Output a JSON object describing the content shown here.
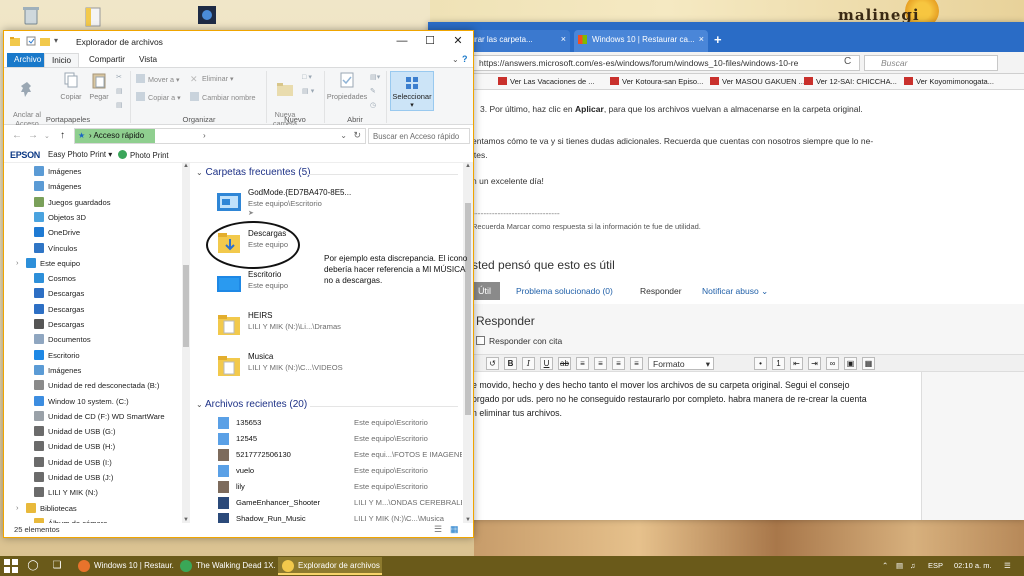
{
  "colors": {
    "accent": "#1979ca",
    "selection": "#cce4f7",
    "explorer_border": "#f0a500",
    "browser_tabbar": "#2a6cc6",
    "taskbar": "#6a5a1a",
    "section_header": "#1e3287",
    "annotation": "#111111"
  },
  "browser": {
    "tabs": [
      {
        "label": "o restaurar las carpeta...",
        "close": "×"
      },
      {
        "label": "Windows 10 | Restaurar ca...",
        "close": "×"
      }
    ],
    "new_tab": "+",
    "url": "https://answers.microsoft.com/es-es/windows/forum/windows_10-files/windows-10-re",
    "reload": "C",
    "search_placeholder": "Buscar",
    "bookmarks": [
      "Ver Las Vacaciones de ...",
      "Ver Kotoura-san Episo...",
      "Ver MASOU GAKUEN ...",
      "Ver 12-SAI: CHICCHA...",
      "Ver Koyomimonogata..."
    ],
    "content": {
      "step_prefix": "3. Por último, haz clic en",
      "step_bold": "Aplicar",
      "step_suffix": ", para que los archivos vuelvan a almacenarse en la carpeta original.",
      "line2a": "entamos cómo te va y si tienes dudas adicionales. Recuerda que cuentas con nosotros siempre que lo ne-",
      "line2b": "ites.",
      "greeting": "n un excelente día!",
      "sep_text": "-------------------------------",
      "helpful_note": "Recuerda Marcar como respuesta si la información te fue de utilidad.",
      "heading": "sted pensó que esto es útil",
      "util": "Útil",
      "solved": "Problema solucionado (0)",
      "reply": "Responder",
      "abuse": "Notificar abuso",
      "reply_title": "Responder",
      "reply_quote": "Responder con cita",
      "format_select": "Formato",
      "reply_body": [
        "e movido, hecho y des hecho tanto el mover los archivos de su carpeta original. Segui el consejo",
        "orgado por uds. pero no he conseguido restaurarlo por completo. habra manera de re-crear la cuenta",
        "n eliminar tus archivos."
      ]
    }
  },
  "explorer": {
    "title": "Explorador de archivos",
    "ribbon_tabs": [
      "Archivo",
      "Inicio",
      "Compartir",
      "Vista"
    ],
    "ribbon": {
      "pin": "Anclar al\nAcceso rápido",
      "copy": "Copiar",
      "paste": "Pegar",
      "group_clipboard": "Portapapeles",
      "move_to": "Mover a",
      "copy_to": "Copiar a",
      "delete": "Eliminar",
      "rename": "Cambiar nombre",
      "group_organize": "Organizar",
      "new_folder": "Nueva\ncarpeta",
      "group_new": "Nuevo",
      "properties": "Propiedades",
      "group_open": "Abrir",
      "select": "Seleccionar"
    },
    "address_path": "Acceso rápido",
    "address_chevron": "›",
    "search_placeholder": "Buscar en Acceso rápido",
    "epson_toolbar": {
      "brand": "EPSON",
      "easy_photo": "Easy Photo Print",
      "photo_print": "Photo Print"
    },
    "nav_items": [
      {
        "label": "Imágenes",
        "icon": "images-icon",
        "level": 1,
        "color": "#5b9bd5"
      },
      {
        "label": "Imágenes",
        "icon": "images-icon",
        "level": 1,
        "color": "#5b9bd5"
      },
      {
        "label": "Juegos guardados",
        "icon": "saved-games-icon",
        "level": 1,
        "color": "#7aa05a"
      },
      {
        "label": "Objetos 3D",
        "icon": "3d-objects-icon",
        "level": 1,
        "color": "#4aa3df"
      },
      {
        "label": "OneDrive",
        "icon": "onedrive-icon",
        "level": 1,
        "color": "#1f7ad3"
      },
      {
        "label": "Vínculos",
        "icon": "links-icon",
        "level": 1,
        "color": "#2f75c5"
      },
      {
        "label": "Este equipo",
        "icon": "this-pc-icon",
        "level": 0,
        "color": "#2d8fd9"
      },
      {
        "label": "Cosmos",
        "icon": "folder-icon",
        "level": 1,
        "color": "#2d8fd9"
      },
      {
        "label": "Descargas",
        "icon": "downloads-icon",
        "level": 1,
        "color": "#2d6fc4"
      },
      {
        "label": "Descargas",
        "icon": "downloads-icon",
        "level": 1,
        "color": "#2d6fc4"
      },
      {
        "label": "Descargas",
        "icon": "downloads-icon",
        "level": 1,
        "color": "#555555"
      },
      {
        "label": "Documentos",
        "icon": "documents-icon",
        "level": 1,
        "color": "#8fa6c0"
      },
      {
        "label": "Escritorio",
        "icon": "desktop-icon",
        "level": 1,
        "color": "#1e88e5"
      },
      {
        "label": "Imágenes",
        "icon": "images-icon",
        "level": 1,
        "color": "#5b9bd5"
      },
      {
        "label": "Unidad de red desconectada (B:)",
        "icon": "network-drive-icon",
        "level": 1,
        "color": "#8a8a8a"
      },
      {
        "label": "Window 10 system. (C:)",
        "icon": "windows-drive-icon",
        "level": 1,
        "color": "#3c8de0"
      },
      {
        "label": "Unidad de CD (F:) WD SmartWare",
        "icon": "cd-drive-icon",
        "level": 1,
        "color": "#9aa1a8"
      },
      {
        "label": "Unidad de USB (G:)",
        "icon": "usb-drive-icon",
        "level": 1,
        "color": "#6b6b6b"
      },
      {
        "label": "Unidad de USB (H:)",
        "icon": "usb-drive-icon",
        "level": 1,
        "color": "#6b6b6b"
      },
      {
        "label": "Unidad de USB (I:)",
        "icon": "usb-drive-icon",
        "level": 1,
        "color": "#6b6b6b"
      },
      {
        "label": "Unidad de USB (J:)",
        "icon": "usb-drive-icon",
        "level": 1,
        "color": "#6b6b6b"
      },
      {
        "label": "LILI Y MIK (N:)",
        "icon": "usb-drive-icon",
        "level": 1,
        "color": "#6b6b6b"
      },
      {
        "label": "Bibliotecas",
        "icon": "libraries-icon",
        "level": 0,
        "color": "#e8b93b"
      },
      {
        "label": "Álbum de cámara",
        "icon": "camera-roll-icon",
        "level": 1,
        "color": "#e8b93b"
      }
    ],
    "frequent_title": "Carpetas frecuentes (5)",
    "frequent": [
      {
        "name": "GodMode.{ED7BA470-8E5...",
        "path": "Este equipo\\Escritorio",
        "icon": "godmode-folder-icon"
      },
      {
        "name": "Descargas",
        "path": "Este equipo",
        "icon": "music-downloads-folder-icon"
      },
      {
        "name": "Escritorio",
        "path": "Este equipo",
        "icon": "desktop-folder-icon"
      },
      {
        "name": "HEIRS",
        "path": "LILI Y MIK (N:)\\Li...\\Dramas",
        "icon": "folder-icon"
      },
      {
        "name": "Musica",
        "path": "LILI Y MIK (N:)\\C...\\VIDEOS",
        "icon": "folder-icon"
      }
    ],
    "recent_title": "Archivos recientes (20)",
    "recent": [
      {
        "name": "135653",
        "path": "Este equipo\\Escritorio",
        "icon": "shortcut-file-icon"
      },
      {
        "name": "12545",
        "path": "Este equipo\\Escritorio",
        "icon": "shortcut-file-icon"
      },
      {
        "name": "5217772506130",
        "path": "Este equi...\\FOTOS E IMAGENES",
        "icon": "image-file-icon"
      },
      {
        "name": "vuelo",
        "path": "Este equipo\\Escritorio",
        "icon": "shortcut-file-icon"
      },
      {
        "name": "lily",
        "path": "Este equipo\\Escritorio",
        "icon": "image-file-icon"
      },
      {
        "name": "GameEnhancer_Shooter",
        "path": "LILI Y M...\\ONDAS CEREBRALES",
        "icon": "audio-file-icon"
      },
      {
        "name": "Shadow_Run_Music",
        "path": "LILI Y MIK (N:)\\C...\\Musica",
        "icon": "audio-file-icon"
      }
    ],
    "annotation": "Por ejemplo esta discrepancia. El icono debería hacer referencia a MI MÚSICA no a descargas.",
    "status": "25 elementos"
  },
  "taskbar": {
    "apps": [
      {
        "label": "Windows 10 | Restaur...",
        "icon": "firefox-icon",
        "active": false
      },
      {
        "label": "The Walking Dead 1X...",
        "icon": "chrome-icon",
        "active": false
      },
      {
        "label": "Explorador de archivos",
        "icon": "file-explorer-icon",
        "active": true
      }
    ],
    "language": "ESP",
    "time": "02:10 a. m."
  }
}
